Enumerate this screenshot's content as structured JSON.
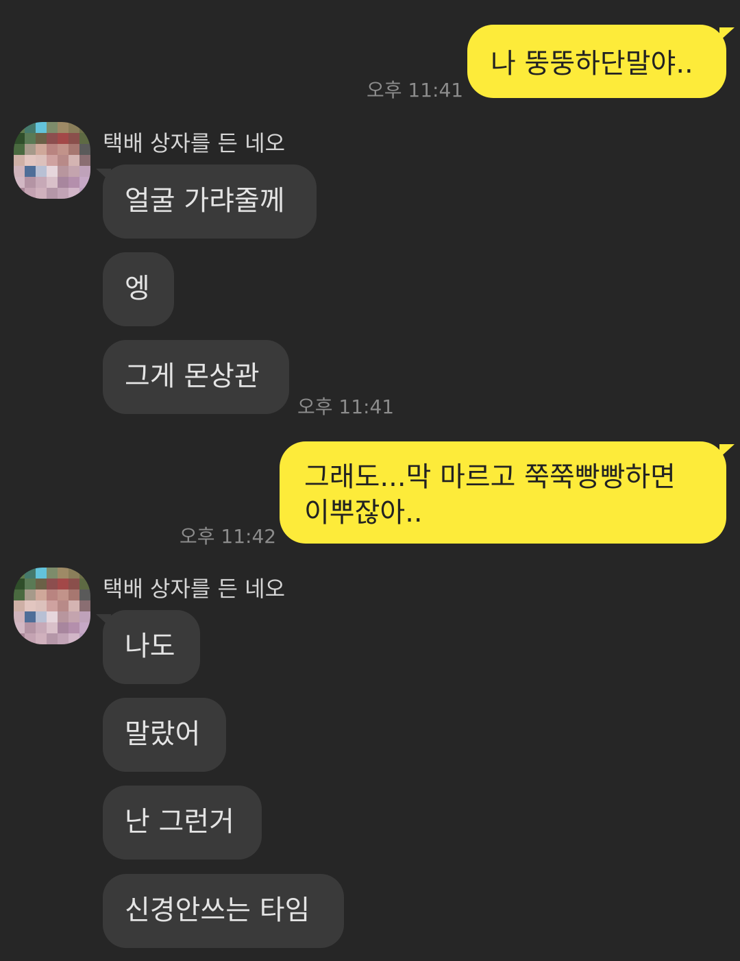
{
  "messages": [
    {
      "text": "나 뚱뚱하단말야..",
      "time": "오후 11:41"
    },
    {
      "sender": "택배 상자를 든 네오"
    },
    {
      "text": "얼굴 가랴줄께"
    },
    {
      "text": "엥"
    },
    {
      "text": "그게 몬상관",
      "time": "오후 11:41"
    },
    {
      "line1": "그래도...막 마르고 쭉쭉빵빵하면",
      "line2": "이뿌잖아..",
      "time": "오후 11:42"
    },
    {
      "sender": "택배 상자를 든 네오"
    },
    {
      "text": "나도"
    },
    {
      "text": "말랐어"
    },
    {
      "text": "난 그런거"
    },
    {
      "text": "신경안쓰는 타임"
    }
  ],
  "colors": {
    "background": "#262626",
    "outgoing_bubble": "#fdeb3a",
    "incoming_bubble": "#3a3a3a",
    "timestamp": "#8c8c8c"
  },
  "avatar_pixels": [
    "#5f7a4c",
    "#45796c",
    "#63c3db",
    "#7d8c6b",
    "#9e8a66",
    "#8a7e5a",
    "#6d6f48",
    "#2f4e2a",
    "#5a7a55",
    "#6b6147",
    "#8c4e4e",
    "#a34848",
    "#8a4f4b",
    "#5e6a43",
    "#4a6a40",
    "#a69a8a",
    "#cfa89a",
    "#b98480",
    "#c2938a",
    "#a77770",
    "#5a5a5a",
    "#ceb0a6",
    "#e2c6c0",
    "#dcc1bc",
    "#cfa2a0",
    "#b88a88",
    "#d4b4b2",
    "#8a6e72",
    "#cfb4bc",
    "#4e6e98",
    "#b8c0d4",
    "#e6d6dc",
    "#b8969e",
    "#c4a4ae",
    "#bfa2ba",
    "#d2b8c4",
    "#b494a4",
    "#c7a9b7",
    "#d9c0c9",
    "#a8869e",
    "#b48fac",
    "#c6a8c6",
    "#a98798",
    "#c4a3b2",
    "#d0b1bd",
    "#b597a8",
    "#c2a4b6",
    "#d2b6c8",
    "#bca0c0"
  ]
}
